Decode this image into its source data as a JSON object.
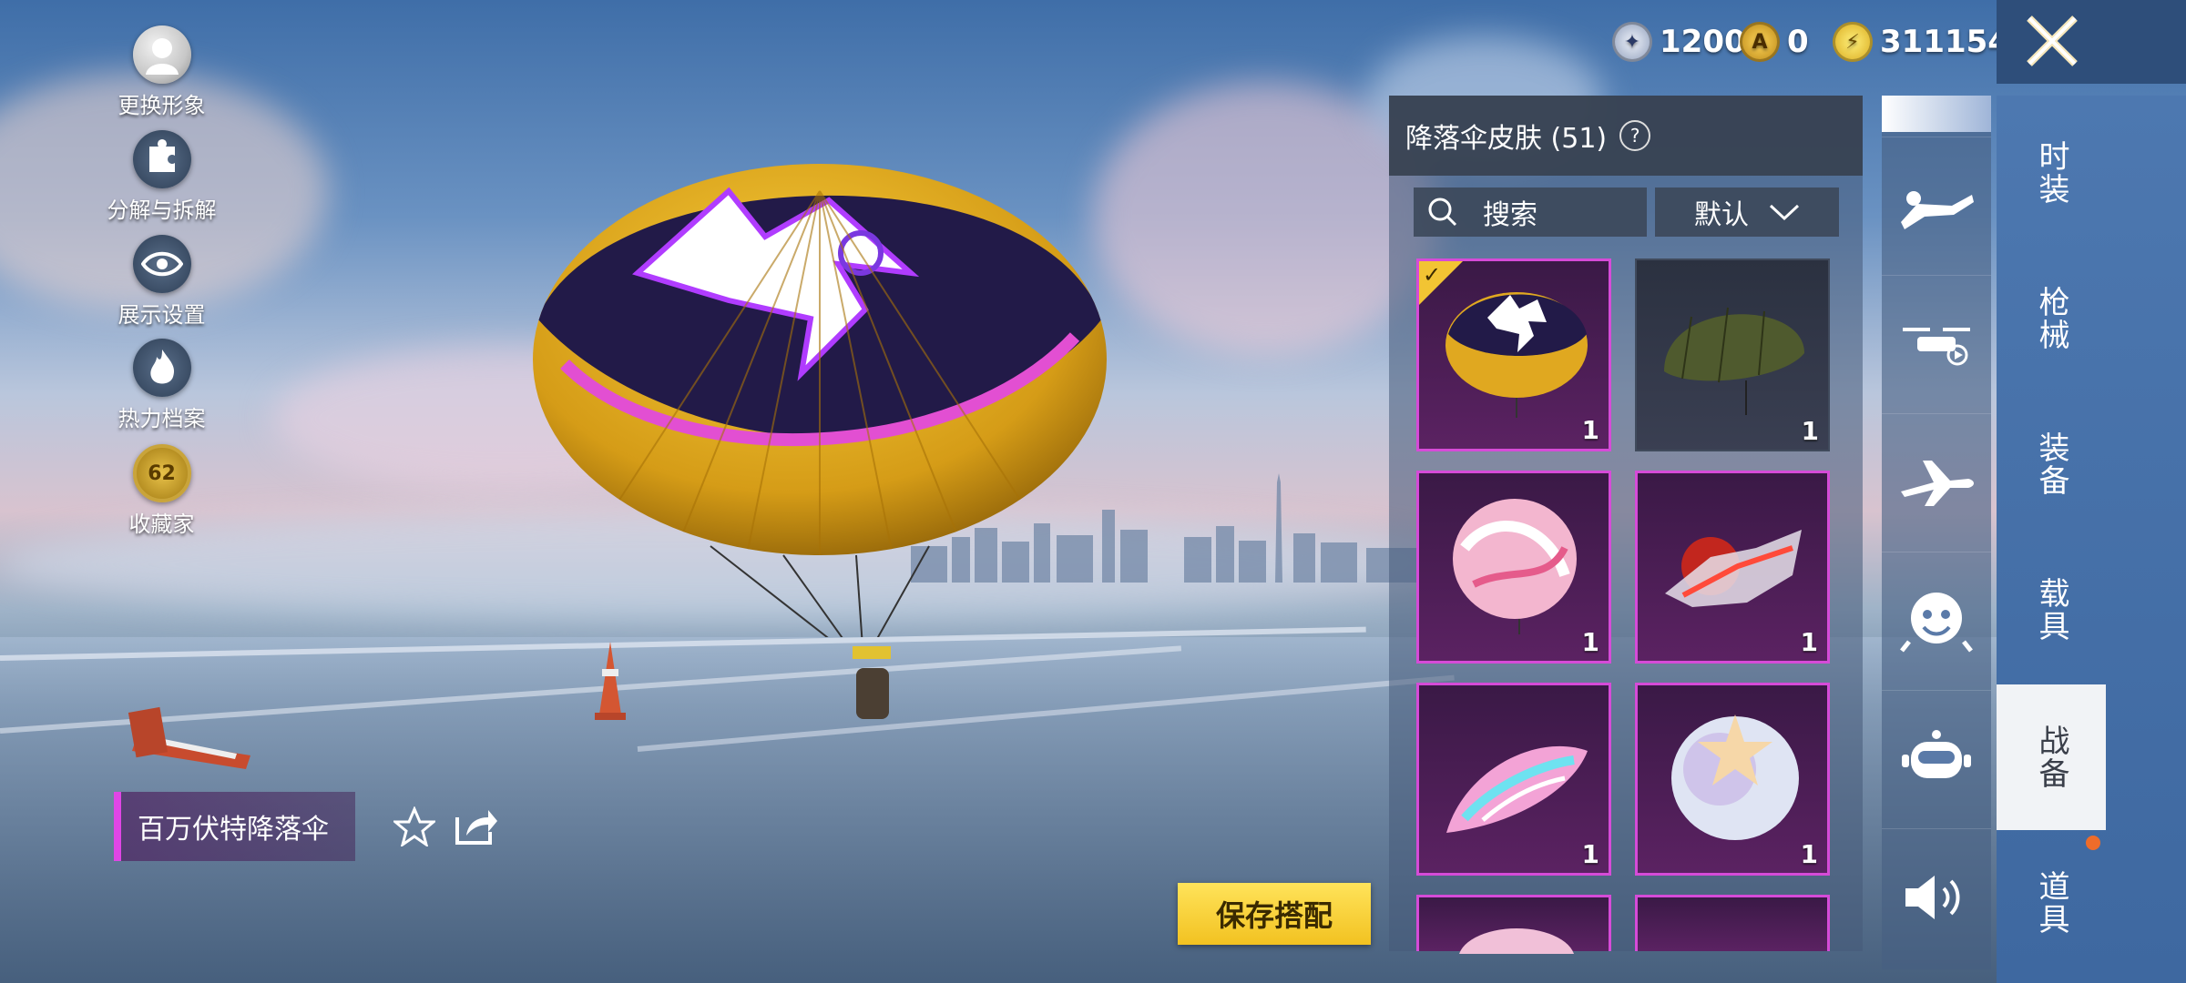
{
  "left_menu": [
    {
      "label": "更换形象",
      "icon": "avatar-icon"
    },
    {
      "label": "分解与拆解",
      "icon": "puzzle-icon"
    },
    {
      "label": "展示设置",
      "icon": "eye-icon"
    },
    {
      "label": "热力档案",
      "icon": "flame-icon"
    },
    {
      "label": "收藏家",
      "icon": "collector-badge-icon",
      "badge": "62"
    }
  ],
  "currency": [
    {
      "icon": "silver-coin-icon",
      "value": "1200",
      "color": "#c9d3e6"
    },
    {
      "icon": "ag-coin-icon",
      "value": "0",
      "color": "#e5b53a"
    },
    {
      "icon": "uc-coin-icon",
      "value": "311154",
      "color": "#f3c93a"
    }
  ],
  "panel": {
    "title": "降落伞皮肤 (51)",
    "help": "?",
    "search_placeholder": "搜索",
    "sort_label": "默认",
    "items": [
      {
        "count": "1",
        "selected": true,
        "style": "smiley-yellow"
      },
      {
        "count": "1",
        "selected": false,
        "style": "military-green"
      },
      {
        "count": "1",
        "selected": false,
        "style": "pink-sweet"
      },
      {
        "count": "1",
        "selected": false,
        "style": "red-flame"
      },
      {
        "count": "1",
        "selected": false,
        "style": "pink-graffiti"
      },
      {
        "count": "1",
        "selected": false,
        "style": "pearl-star"
      },
      {
        "count": "",
        "selected": false,
        "style": "pink-partial"
      },
      {
        "count": "",
        "selected": false,
        "style": "dark-partial"
      }
    ]
  },
  "category_icons": [
    "skydiver-icon",
    "drone-icon",
    "airplane-icon",
    "emote-icon",
    "robot-icon",
    "speaker-icon"
  ],
  "tabs": [
    {
      "label": "时装",
      "active": false
    },
    {
      "label": "枪械",
      "active": false
    },
    {
      "label": "装备",
      "active": false
    },
    {
      "label": "载具",
      "active": false
    },
    {
      "label": "战备",
      "active": true
    },
    {
      "label": "道具",
      "active": false
    }
  ],
  "item_name": "百万伏特降落伞",
  "save_button": "保存搭配",
  "colors": {
    "accent_magenta": "#d64bd8",
    "save_yellow": "#f2c221",
    "notify_orange": "#ee6c2a"
  }
}
